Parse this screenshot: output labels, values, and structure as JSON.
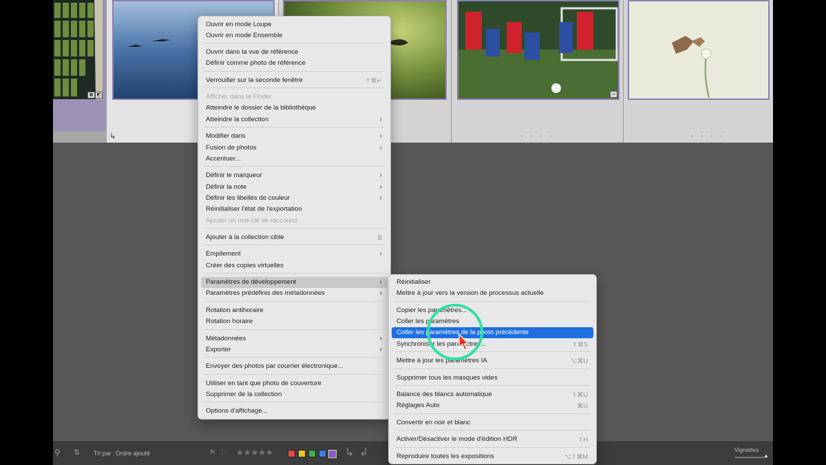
{
  "context_menu": {
    "items": [
      {
        "label": "Ouvrir en mode Loupe"
      },
      {
        "label": "Ouvrir en mode Ensemble"
      },
      {
        "label": "Ouvrir dans la vue de référence"
      },
      {
        "label": "Définir comme photo de référence"
      },
      {
        "label": "Verrouiller sur la seconde fenêtre",
        "shortcut": "⇧⌘↵"
      },
      {
        "label": "Afficher dans le Finder",
        "disabled": true
      },
      {
        "label": "Atteindre le dossier de la bibliothèque"
      },
      {
        "label": "Atteindre la collection",
        "submenu": true
      },
      {
        "label": "Modifier dans",
        "submenu": true
      },
      {
        "label": "Fusion de photos",
        "submenu": true
      },
      {
        "label": "Accentuer..."
      },
      {
        "label": "Définir le marqueur",
        "submenu": true
      },
      {
        "label": "Définir la note",
        "submenu": true
      },
      {
        "label": "Définir les libellés de couleur",
        "submenu": true
      },
      {
        "label": "Réinitialiser l'état de l'exportation"
      },
      {
        "label": "Ajouter un mot-clé de raccourci",
        "disabled": true
      },
      {
        "label": "Ajouter à la collection cible",
        "shortcut": "B"
      },
      {
        "label": "Empilement",
        "submenu": true
      },
      {
        "label": "Créer des copies virtuelles"
      },
      {
        "label": "Paramètres de développement",
        "submenu": true,
        "highlighted": true
      },
      {
        "label": "Paramètres prédéfinis des métadonnées",
        "submenu": true
      },
      {
        "label": "Rotation antihoraire"
      },
      {
        "label": "Rotation horaire"
      },
      {
        "label": "Métadonnées",
        "submenu": true
      },
      {
        "label": "Exporter",
        "submenu": true
      },
      {
        "label": "Envoyer des photos par courrier électronique..."
      },
      {
        "label": "Utiliser en tant que photo de couverture"
      },
      {
        "label": "Supprimer de la collection"
      },
      {
        "label": "Options d'affichage..."
      }
    ]
  },
  "submenu": {
    "items": [
      {
        "label": "Réinitialiser"
      },
      {
        "label": "Mettre à jour vers la version de processus actuelle"
      },
      {
        "label": "Copier les paramètres..."
      },
      {
        "label": "Coller les paramètres"
      },
      {
        "label": "Coller les paramètres de la photo précédente",
        "selected": true
      },
      {
        "label": "Synchroniser les paramètres...",
        "shortcut": "⇧⌘S"
      },
      {
        "label": "Mettre à jour les paramètres IA",
        "shortcut": "⌥⌘U"
      },
      {
        "label": "Supprimer tous les masques vides"
      },
      {
        "label": "Balance des blancs automatique",
        "shortcut": "⇧⌘U"
      },
      {
        "label": "Réglages Auto",
        "shortcut": "⌘U"
      },
      {
        "label": "Convertir en noir et blanc"
      },
      {
        "label": "Activer/Désactiver le mode d'édition HDR",
        "shortcut": "⇧H"
      },
      {
        "label": "Reproduire toutes les expositions",
        "shortcut": "⌥⇧⌘M"
      }
    ]
  },
  "toolbar": {
    "sort_label": "Tri par :",
    "sort_value": "Ordre ajouté",
    "stars": "★★★★★",
    "color_labels": [
      "#e04848",
      "#e6c52a",
      "#3fae49",
      "#3e7fe0",
      "#8a56c9"
    ],
    "vignettes_label": "Vignettes"
  },
  "grid": {
    "dots": "· · · ·"
  },
  "icons": {
    "badge": "adjust-badge-icon",
    "return_arrow": "return-arrow-icon",
    "flag": "flag-icon",
    "chevron": "chevron-right-icon"
  }
}
